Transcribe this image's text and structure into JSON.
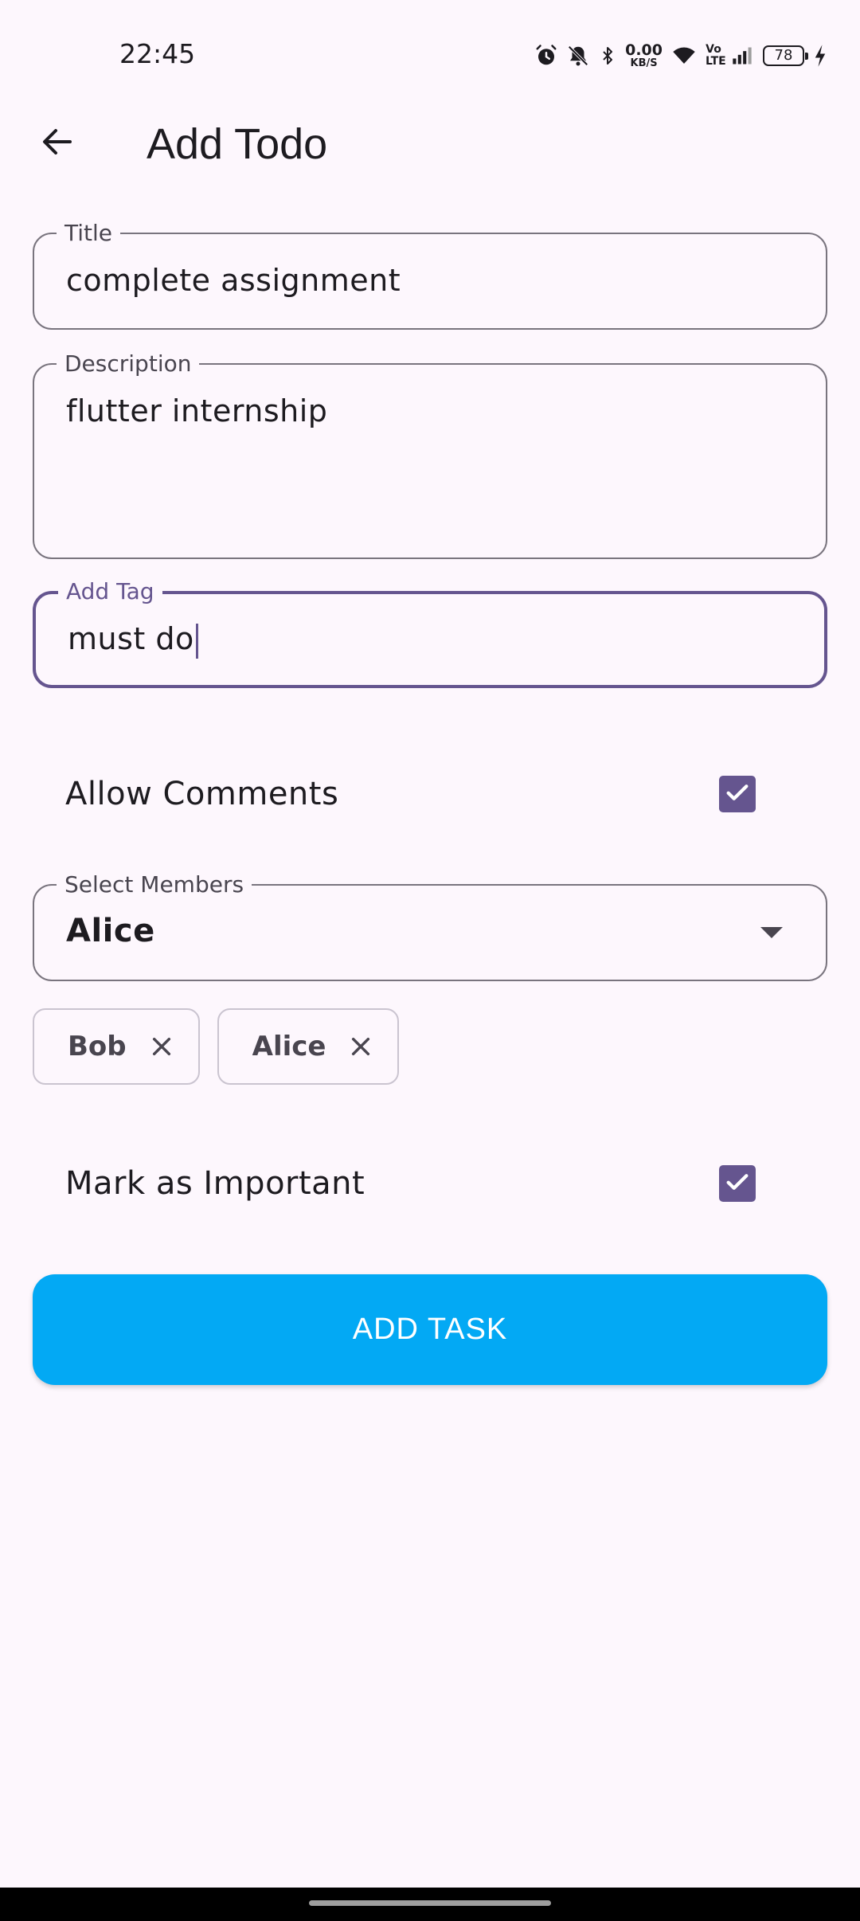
{
  "status_bar": {
    "time": "22:45",
    "net_speed_value": "0.00",
    "net_speed_unit": "KB/S",
    "volte": "Vo\nLTE",
    "battery": "78",
    "icons": [
      "alarm-icon",
      "bell-off-icon",
      "bluetooth-icon",
      "wifi-icon",
      "signal-icon",
      "battery-icon",
      "charging-icon"
    ]
  },
  "app_bar": {
    "title": "Add Todo",
    "back_icon": "arrow-left-icon"
  },
  "form": {
    "title_field": {
      "label": "Title",
      "value": "complete assignment"
    },
    "description_field": {
      "label": "Description",
      "value": "flutter internship"
    },
    "tag_field": {
      "label": "Add Tag",
      "value": "must do"
    },
    "allow_comments": {
      "label": "Allow Comments",
      "checked": true
    },
    "members": {
      "label": "Select Members",
      "selected": "Alice",
      "chips": [
        "Bob",
        "Alice"
      ]
    },
    "mark_important": {
      "label": "Mark as Important",
      "checked": true
    },
    "submit_label": "ADD TASK"
  },
  "colors": {
    "background": "#fdf7fd",
    "primary": "#65558f",
    "outline": "#79747e",
    "button": "#03a9f4"
  }
}
